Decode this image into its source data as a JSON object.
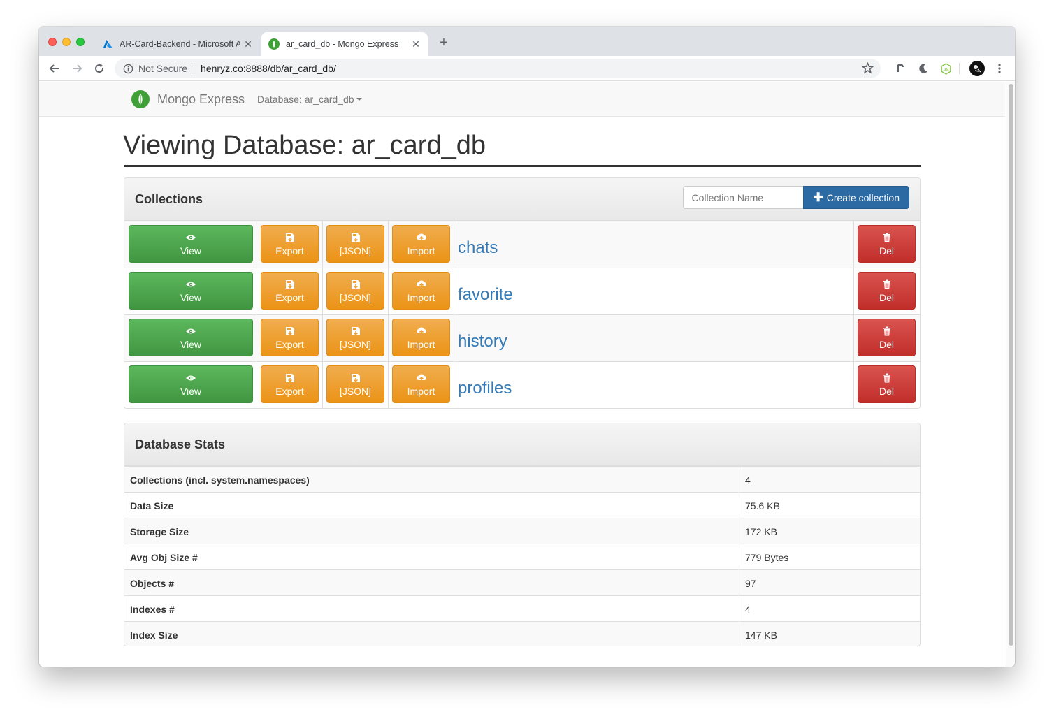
{
  "browser": {
    "tabs": [
      {
        "title": "AR-Card-Backend - Microsoft Azure",
        "active": false
      },
      {
        "title": "ar_card_db - Mongo Express",
        "active": true
      }
    ],
    "address": {
      "security": "Not Secure",
      "url": "henryz.co:8888/db/ar_card_db/"
    }
  },
  "navbar": {
    "brand": "Mongo Express",
    "database_menu": "Database: ar_card_db"
  },
  "page": {
    "title": "Viewing Database: ar_card_db"
  },
  "collections": {
    "heading": "Collections",
    "new_collection_placeholder": "Collection Name",
    "create_label": "Create collection",
    "actions": {
      "view": "View",
      "export": "Export",
      "json": "[JSON]",
      "import": "Import",
      "delete": "Del"
    },
    "items": [
      "chats",
      "favorite",
      "history",
      "profiles"
    ]
  },
  "stats": {
    "heading": "Database Stats",
    "rows": [
      {
        "label": "Collections (incl. system.namespaces)",
        "value": "4"
      },
      {
        "label": "Data Size",
        "value": "75.6 KB"
      },
      {
        "label": "Storage Size",
        "value": "172 KB"
      },
      {
        "label": "Avg Obj Size #",
        "value": "779 Bytes"
      },
      {
        "label": "Objects #",
        "value": "97"
      },
      {
        "label": "Indexes #",
        "value": "4"
      },
      {
        "label": "Index Size",
        "value": "147 KB"
      }
    ]
  },
  "colors": {
    "view": "#5cb85c",
    "warning": "#f0ad4e",
    "danger": "#d9534f",
    "primary": "#2b6aa3",
    "link": "#337ab7",
    "brand_leaf": "#3fa037"
  }
}
